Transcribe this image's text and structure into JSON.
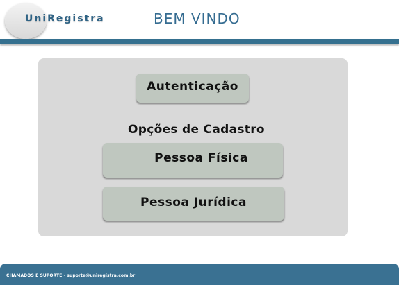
{
  "header": {
    "logo_text": "UniRegistra",
    "welcome_text": "BEM VINDO"
  },
  "main": {
    "auth_button": "Autenticação",
    "section_title": "Opções de Cadastro",
    "pessoa_fisica_button": "Pessoa Física",
    "pessoa_juridica_button": "Pessoa Jurídica"
  },
  "footer": {
    "support_text": "CHAMADOS E SUPORTE - suporte@uniregistra.com.br"
  },
  "colors": {
    "primary_blue": "#35708f",
    "panel_gray": "#d9d9d9",
    "button_gray": "#bfc7bf"
  }
}
